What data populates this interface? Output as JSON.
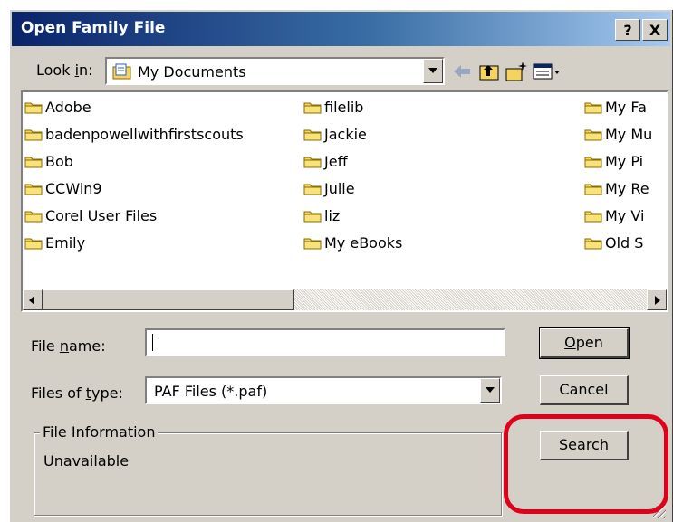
{
  "window": {
    "title": "Open Family File",
    "help_label": "?",
    "close_label": "X"
  },
  "lookin": {
    "label_prefix": "Look ",
    "label_accel": "i",
    "label_suffix": "n:",
    "value": "My Documents"
  },
  "toolbar": {
    "icons": [
      "back-arrow-icon",
      "up-folder-icon",
      "new-folder-icon",
      "view-menu-icon"
    ]
  },
  "files": {
    "col1": [
      "Adobe",
      "badenpowellwithfirstscouts",
      "Bob",
      "CCWin9",
      "Corel User Files",
      "Emily"
    ],
    "col2": [
      "filelib",
      "Jackie",
      "Jeff",
      "Julie",
      "liz",
      "My eBooks"
    ],
    "col3": [
      "My Fa",
      "My Mu",
      "My Pi",
      "My Re",
      "My Vi",
      "Old S"
    ]
  },
  "filename": {
    "label_prefix": "File ",
    "label_accel": "n",
    "label_suffix": "ame:",
    "value": ""
  },
  "filetype": {
    "label_prefix": "Files of ",
    "label_accel": "t",
    "label_suffix": "ype:",
    "value": "PAF Files (*.paf)"
  },
  "buttons": {
    "open_accel": "O",
    "open_rest": "pen",
    "cancel": "Cancel",
    "search": "Search"
  },
  "fileinfo": {
    "legend": "File Information",
    "status": "Unavailable"
  },
  "colors": {
    "titlebar_start": "#0a246a",
    "dialog_bg": "#d4d0c8",
    "highlight": "#e0001b",
    "folder": "#f4d35e"
  }
}
